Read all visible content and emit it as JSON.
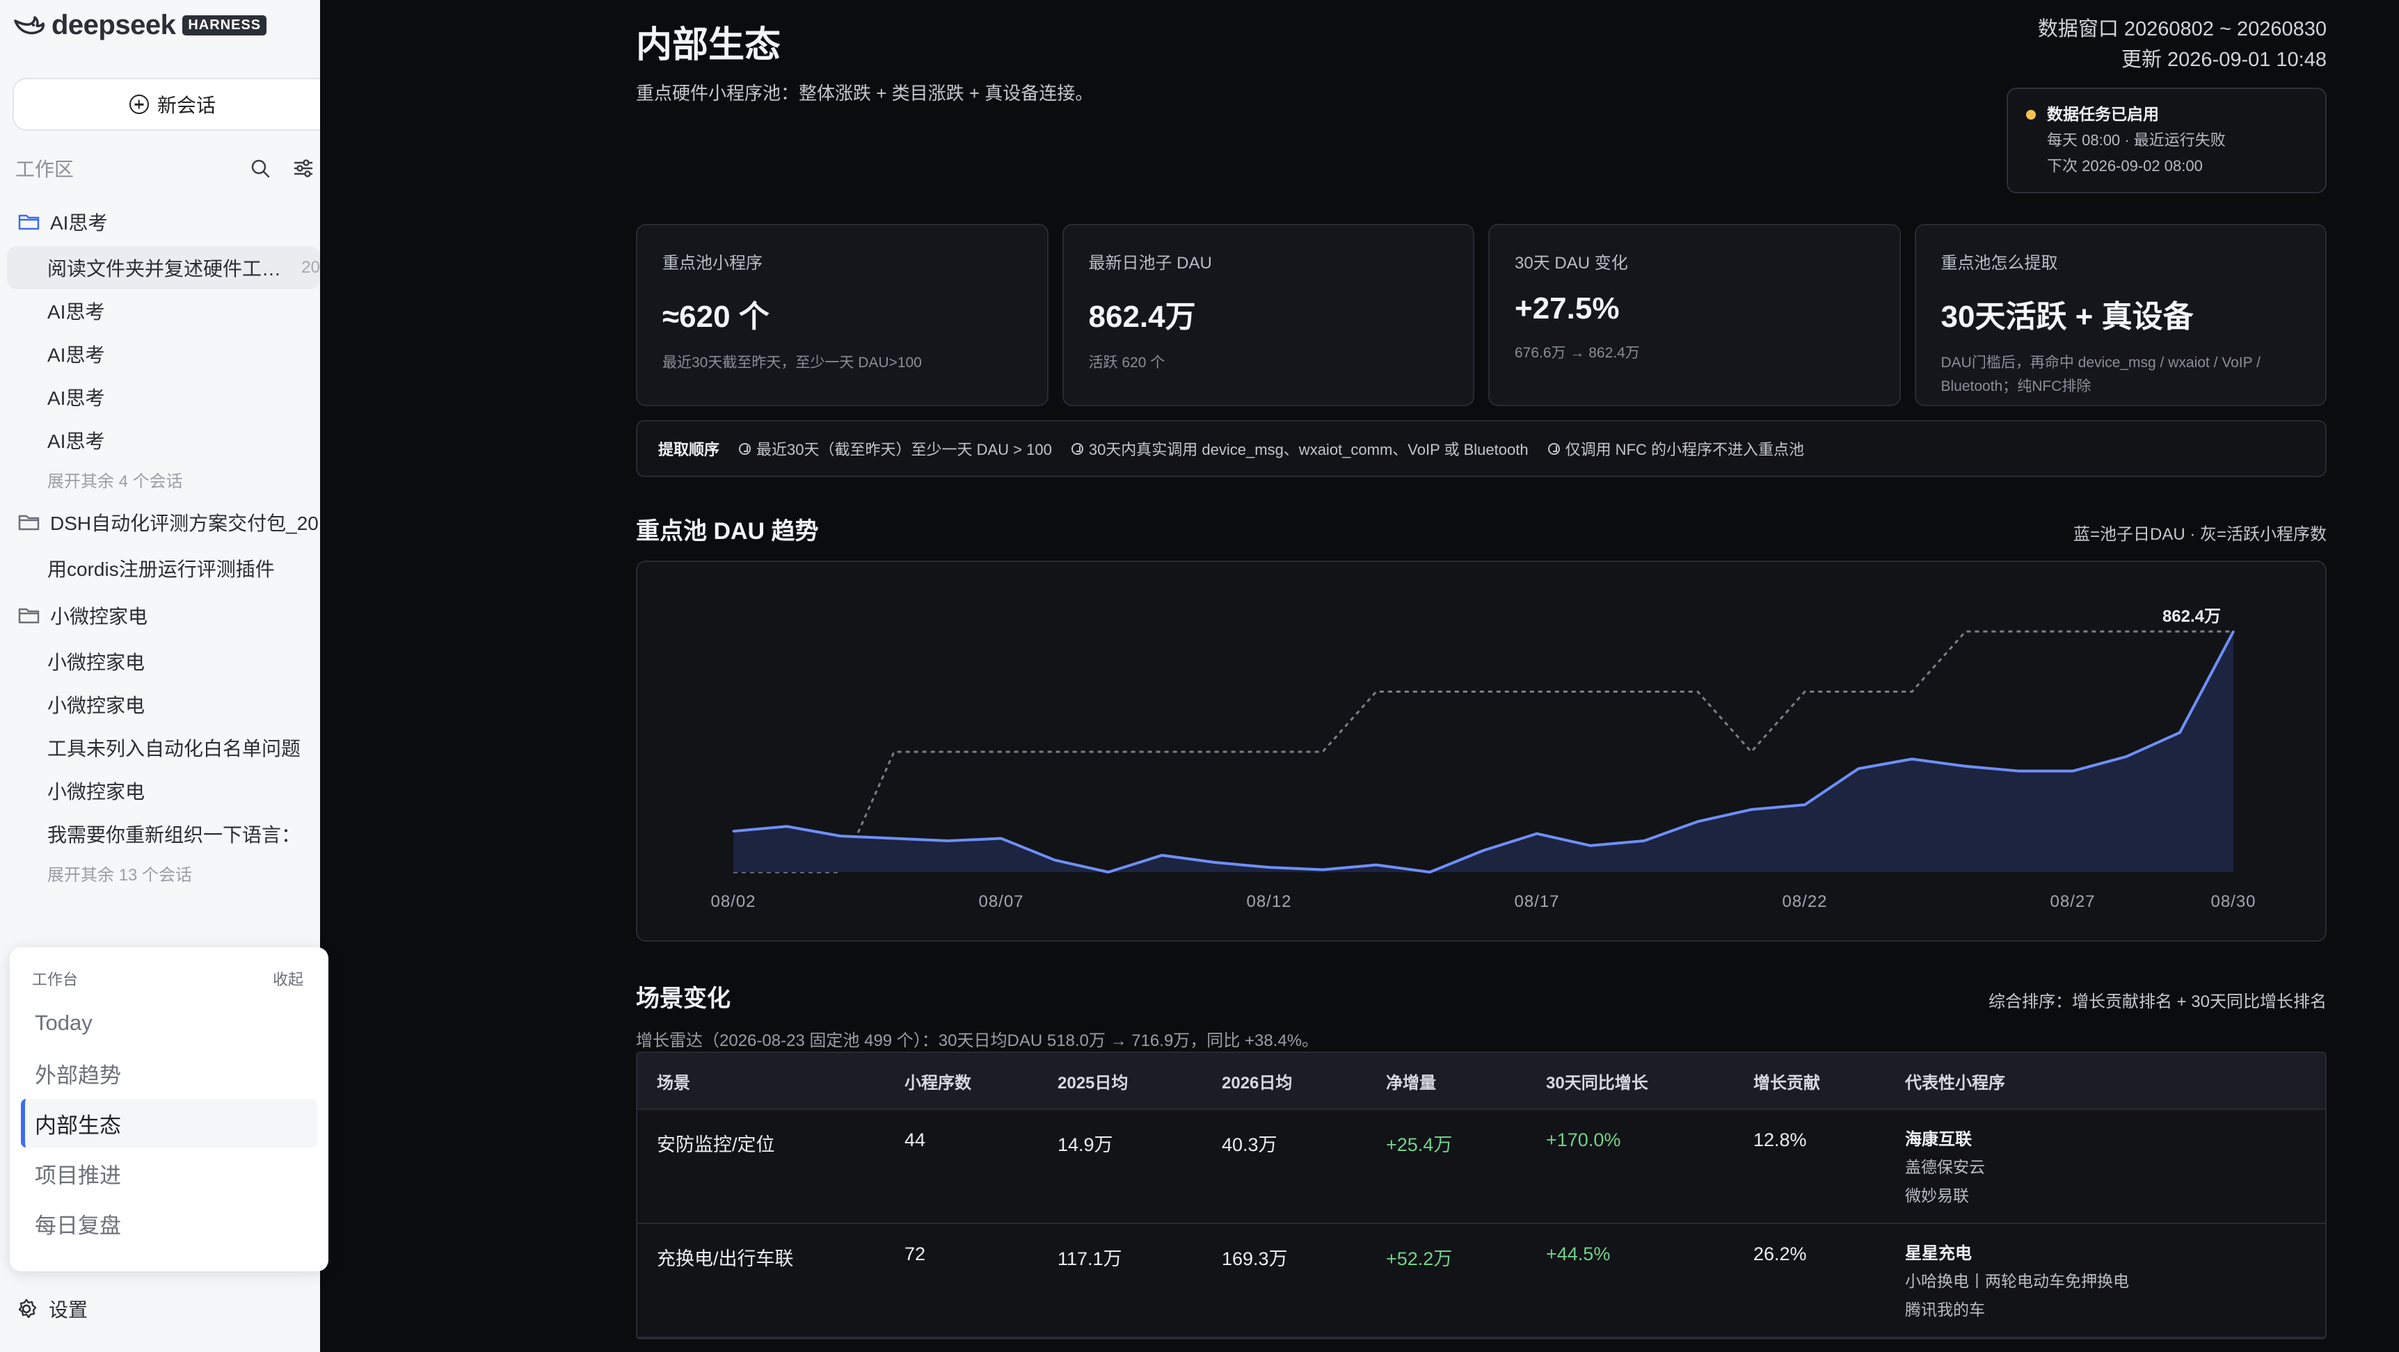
{
  "sidebar": {
    "brand": {
      "name": "deepseek",
      "badge": "HARNESS"
    },
    "new_chat": "新会话",
    "workspace_label": "工作区",
    "groups": [
      {
        "folder": "AI思考",
        "items": [
          "阅读文件夹并复述硬件工…",
          "AI思考",
          "AI思考",
          "AI思考",
          "AI思考"
        ],
        "active_date": "20",
        "more": "展开其余 4 个会话"
      },
      {
        "folder": "DSH自动化评测方案交付包_20",
        "items": [
          "用cordis注册运行评测插件"
        ]
      },
      {
        "folder": "小微控家电",
        "items": [
          "小微控家电",
          "小微控家电",
          "工具未列入自动化白名单问题",
          "小微控家电",
          "我需要你重新组织一下语言："
        ],
        "more": "展开其余 13 个会话"
      }
    ],
    "workbench": {
      "title": "工作台",
      "collapse": "收起",
      "items": [
        "Today",
        "外部趋势",
        "内部生态",
        "项目推进",
        "每日复盘"
      ]
    },
    "settings": "设置"
  },
  "header": {
    "title": "内部生态",
    "subtitle": "重点硬件小程序池：整体涨跌 + 类目涨跌 + 真设备连接。",
    "window": "数据窗口 20260802 ~ 20260830",
    "updated": "更新 2026-09-01 10:48"
  },
  "task": {
    "title": "数据任务已启用",
    "line1": "每天 08:00 · 最近运行失败",
    "line2": "下次 2026-09-02 08:00",
    "status_color": "#f2c14e"
  },
  "cards": [
    {
      "label": "重点池小程序",
      "value": "≈620 个",
      "note": "最近30天截至昨天，至少一天 DAU>100"
    },
    {
      "label": "最新日池子 DAU",
      "value": "862.4万",
      "note": "活跃 620 个"
    },
    {
      "label": "30天 DAU 变化",
      "value": "+27.5%",
      "note": "676.6万 → 862.4万"
    },
    {
      "label": "重点池怎么提取",
      "value": "30天活跃 + 真设备",
      "note": "DAU门槛后，再命中 device_msg / wxaiot / VoIP / Bluetooth；纯NFC排除"
    }
  ],
  "extraction": {
    "title": "提取顺序",
    "steps": [
      "最近30天（截至昨天）至少一天 DAU > 100",
      "30天内真实调用 device_msg、wxaiot_comm、VoIP 或 Bluetooth",
      "仅调用 NFC 的小程序不进入重点池"
    ]
  },
  "trend": {
    "title": "重点池 DAU 趋势",
    "legend": "蓝=池子日DAU · 灰=活跃小程序数"
  },
  "chart_data": {
    "type": "area",
    "x": [
      "08/02",
      "08/03",
      "08/04",
      "08/05",
      "08/06",
      "08/07",
      "08/08",
      "08/09",
      "08/10",
      "08/11",
      "08/12",
      "08/13",
      "08/14",
      "08/15",
      "08/16",
      "08/17",
      "08/18",
      "08/19",
      "08/20",
      "08/21",
      "08/22",
      "08/23",
      "08/24",
      "08/25",
      "08/26",
      "08/27",
      "08/28",
      "08/29",
      "08/30"
    ],
    "xticks": [
      "08/02",
      "08/07",
      "08/12",
      "08/17",
      "08/22",
      "08/27",
      "08/30"
    ],
    "series": [
      {
        "values": [
          0.17,
          0.19,
          0.15,
          0.14,
          0.13,
          0.14,
          0.05,
          0.0,
          0.07,
          0.04,
          0.02,
          0.01,
          0.03,
          0.0,
          0.09,
          0.16,
          0.11,
          0.13,
          0.21,
          0.26,
          0.28,
          0.43,
          0.47,
          0.44,
          0.42,
          0.42,
          0.48,
          0.58,
          1.0
        ],
        "color": "#6f8ff7",
        "style": "area"
      },
      {
        "values": [
          0,
          0,
          0,
          0.5,
          0.5,
          0.5,
          0.5,
          0.5,
          0.5,
          0.5,
          0.5,
          0.5,
          0.75,
          0.75,
          0.75,
          0.75,
          0.75,
          0.75,
          0.75,
          0.5,
          0.75,
          0.75,
          0.75,
          1,
          1,
          1,
          1,
          1,
          1
        ],
        "color": "#7a7e87",
        "style": "dashed"
      }
    ],
    "end_label": "862.4万",
    "grid": false
  },
  "scenes": {
    "title": "场景变化",
    "sort_hint": "综合排序：增长贡献排名 + 30天同比增长排名",
    "radar": "增长雷达（2026-08-23 固定池 499 个）：30天日均DAU 518.0万 → 716.9万，同比 +38.4%。",
    "columns": [
      "场景",
      "小程序数",
      "2025日均",
      "2026日均",
      "净增量",
      "30天同比增长",
      "增长贡献",
      "代表性小程序"
    ],
    "rows": [
      {
        "scene": "安防监控/定位",
        "count": "44",
        "avg2025": "14.9万",
        "avg2026": "40.3万",
        "net": "+25.4万",
        "yoy": "+170.0%",
        "contrib": "12.8%",
        "rep_main": "海康互联",
        "rep_sub1": "盖德保安云",
        "rep_sub2": "微妙易联"
      },
      {
        "scene": "充换电/出行车联",
        "count": "72",
        "avg2025": "117.1万",
        "avg2026": "169.3万",
        "net": "+52.2万",
        "yoy": "+44.5%",
        "contrib": "26.2%",
        "rep_main": "星星充电",
        "rep_sub1": "小哈换电丨两轮电动车免押换电",
        "rep_sub2": "腾讯我的车"
      }
    ]
  }
}
